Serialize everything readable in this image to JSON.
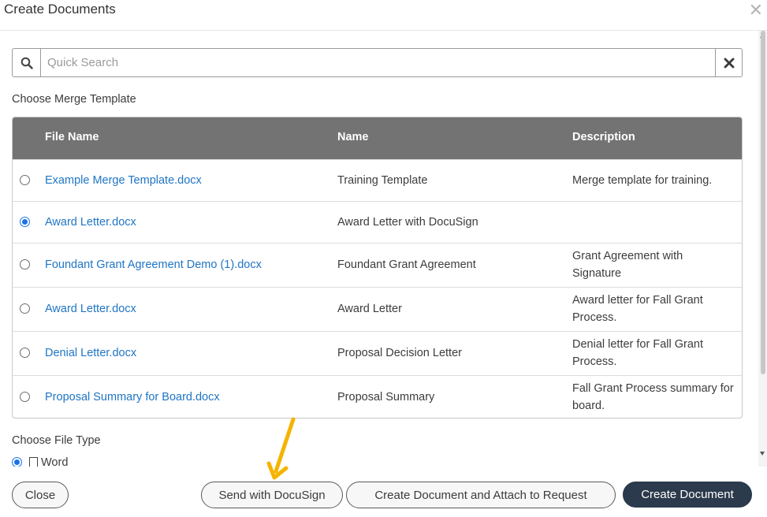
{
  "dialog": {
    "title": "Create Documents",
    "close_glyph": "✕"
  },
  "search": {
    "placeholder": "Quick Search",
    "value": ""
  },
  "template_section": {
    "label": "Choose Merge Template",
    "columns": [
      "File Name",
      "Name",
      "Description"
    ],
    "rows": [
      {
        "file": "Example Merge Template.docx",
        "name": "Training Template",
        "description": "Merge template for training.",
        "selected": false
      },
      {
        "file": "Award Letter.docx",
        "name": "Award Letter with DocuSign",
        "description": "",
        "selected": true
      },
      {
        "file": "Foundant Grant Agreement Demo (1).docx",
        "name": "Foundant Grant Agreement",
        "description": "Grant Agreement with Signature",
        "selected": false
      },
      {
        "file": "Award Letter.docx",
        "name": "Award Letter",
        "description": "Award letter for Fall Grant Process.",
        "selected": false
      },
      {
        "file": "Denial Letter.docx",
        "name": "Proposal Decision Letter",
        "description": "Denial letter for Fall Grant Process.",
        "selected": false
      },
      {
        "file": "Proposal Summary for Board.docx",
        "name": "Proposal Summary",
        "description": "Fall Grant Process summary for board.",
        "selected": false
      }
    ]
  },
  "filetype_section": {
    "label": "Choose File Type",
    "option_label": "Word",
    "option_icon": "document-icon"
  },
  "footer": {
    "close_label": "Close",
    "docusign_label": "Send with DocuSign",
    "attach_label": "Create Document and Attach to Request",
    "create_label": "Create Document"
  },
  "colors": {
    "link": "#1f75c4",
    "header_bg": "#737373",
    "primary_button": "#2b3a4c",
    "annotation_arrow": "#f5b400"
  }
}
